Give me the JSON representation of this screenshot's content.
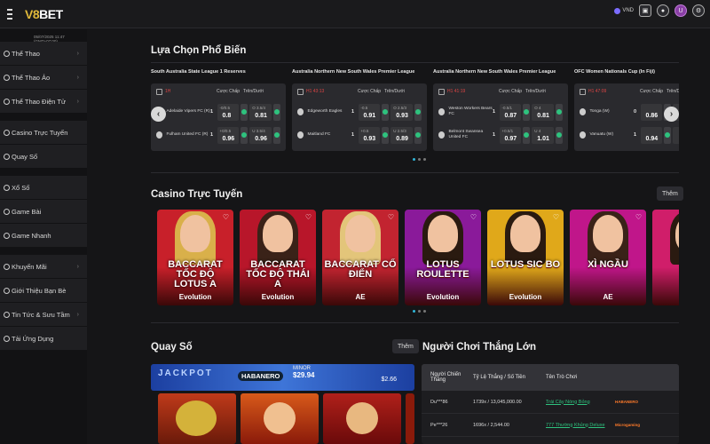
{
  "header": {
    "logo": "BET",
    "logo_mark": "V8",
    "currency": "VND",
    "avatar": "U"
  },
  "sidebar": {
    "datetime": "05/07/2025 11:47 (GMT+07:00)",
    "items": [
      {
        "label": "Thể Thao",
        "arrow": true
      },
      {
        "label": "Thể Thao Ảo",
        "arrow": true
      },
      {
        "label": "Thể Thao Điện Tử",
        "arrow": true
      },
      {
        "label": "Casino Trực Tuyến",
        "arrow": false
      },
      {
        "label": "Quay Số",
        "arrow": false
      },
      {
        "label": "Xổ Số",
        "arrow": false
      },
      {
        "label": "Game Bài",
        "arrow": false
      },
      {
        "label": "Game Nhanh",
        "arrow": false
      },
      {
        "label": "Khuyến Mãi",
        "arrow": true
      },
      {
        "label": "Giới Thiệu Bạn Bè",
        "arrow": false
      },
      {
        "label": "Tin Tức & Sưu Tầm",
        "arrow": true
      },
      {
        "label": "Tải Ứng Dụng",
        "arrow": false
      }
    ]
  },
  "popular": {
    "title": "Lựa Chọn Phổ Biến",
    "col_handicap": "Cược Chấp",
    "col_ou": "Trên/Dưới",
    "matches": [
      {
        "league": "South Australia State League 1 Reserves",
        "time": "1H",
        "home": {
          "name": "Adelaide Vipers FC (R)",
          "score": "1",
          "hcap_line": "-0/0.5",
          "hcap": "0.8",
          "ou_line": "O 3.5/4",
          "ou": "0.81"
        },
        "away": {
          "name": "Fulham United FC (R)",
          "score": "1",
          "hcap_line": "+0/0.5",
          "hcap": "0.96",
          "ou_line": "U 3.5/4",
          "ou": "0.96"
        }
      },
      {
        "league": "Australia Northern New South Wales Premier League",
        "time": "H1 43:13",
        "home": {
          "name": "Edgeworth Eagles",
          "score": "1",
          "hcap_line": "-0.5",
          "hcap": "0.91",
          "ou_line": "O 2.5/3",
          "ou": "0.93"
        },
        "away": {
          "name": "Maitland FC",
          "score": "1",
          "hcap_line": "+0.5",
          "hcap": "0.93",
          "ou_line": "U 2.5/3",
          "ou": "0.89"
        }
      },
      {
        "league": "Australia Northern New South Wales Premier League",
        "time": "H1 41:19",
        "home": {
          "name": "Weston Workers Bears FC",
          "score": "1",
          "hcap_line": "-0.5/1",
          "hcap": "0.87",
          "ou_line": "O 4",
          "ou": "0.81"
        },
        "away": {
          "name": "Belmont Swansea United FC",
          "score": "1",
          "hcap_line": "+0.5/1",
          "hcap": "0.97",
          "ou_line": "U 4",
          "ou": "1.01"
        }
      },
      {
        "league": "OFC Women Nationals Cup (In Fiji)",
        "time": "H1 47:09",
        "home": {
          "name": "Tonga (W)",
          "score": "0",
          "hcap_line": "",
          "hcap": "0.86",
          "ou_line": "",
          "ou": ""
        },
        "away": {
          "name": "Vanuatu (W)",
          "score": "1",
          "hcap_line": "",
          "hcap": "0.94",
          "ou_line": "",
          "ou": ""
        }
      }
    ]
  },
  "casino": {
    "title": "Casino Trực Tuyến",
    "more": "Thêm",
    "games": [
      {
        "name": "BACCARAT TỐC ĐỘ LOTUS A",
        "provider": "Evolution",
        "bg": "#c8202a",
        "hair": "#d9b04a"
      },
      {
        "name": "BACCARAT TỐC ĐỘ THÁI A",
        "provider": "Evolution",
        "bg": "#b8162a",
        "hair": "#3a2218"
      },
      {
        "name": "BACCARAT CỔ ĐIỂN",
        "provider": "AE",
        "bg": "#c22430",
        "hair": "#e3c57a"
      },
      {
        "name": "LOTUS ROULETTE",
        "provider": "Evolution",
        "bg": "#8a1a9a",
        "hair": "#2a1a10"
      },
      {
        "name": "LOTUS SIC BO",
        "provider": "Evolution",
        "bg": "#e0a81a",
        "hair": "#2a1a10"
      },
      {
        "name": "XÌ NGẦU",
        "provider": "AE",
        "bg": "#c0168a",
        "hair": "#3a2218"
      },
      {
        "name": "RO",
        "provider": "",
        "bg": "#d01e6a",
        "hair": "#2a1a10"
      }
    ]
  },
  "lottery": {
    "title": "Quay Số",
    "more": "Thêm",
    "jackpot": "JACKPOT",
    "brand": "HABANERO",
    "minor_label": "MINOR",
    "minor_value": "$29.94",
    "major_value": "$2.66"
  },
  "winners": {
    "title": "Người Chơi Thắng Lớn",
    "col_player": "Người Chiến Thắng",
    "col_rate": "Tỷ Lệ Thắng / Số Tiền",
    "col_game": "Tên Trò Chơi",
    "rows": [
      {
        "player": "Du***86",
        "rate": "1739x / 13,045,000.00",
        "game": "Trái Cây Nóng Bỏng",
        "provider": "HABANERO"
      },
      {
        "player": "Pe***26",
        "rate": "1696x / 2,544.00",
        "game": "777 Thường Khủng Deluxe",
        "provider": "Microgaming"
      }
    ]
  },
  "colors": {
    "accent_gold": "#e0b93a",
    "live_red": "#dd4444",
    "green": "#2ec27e"
  }
}
